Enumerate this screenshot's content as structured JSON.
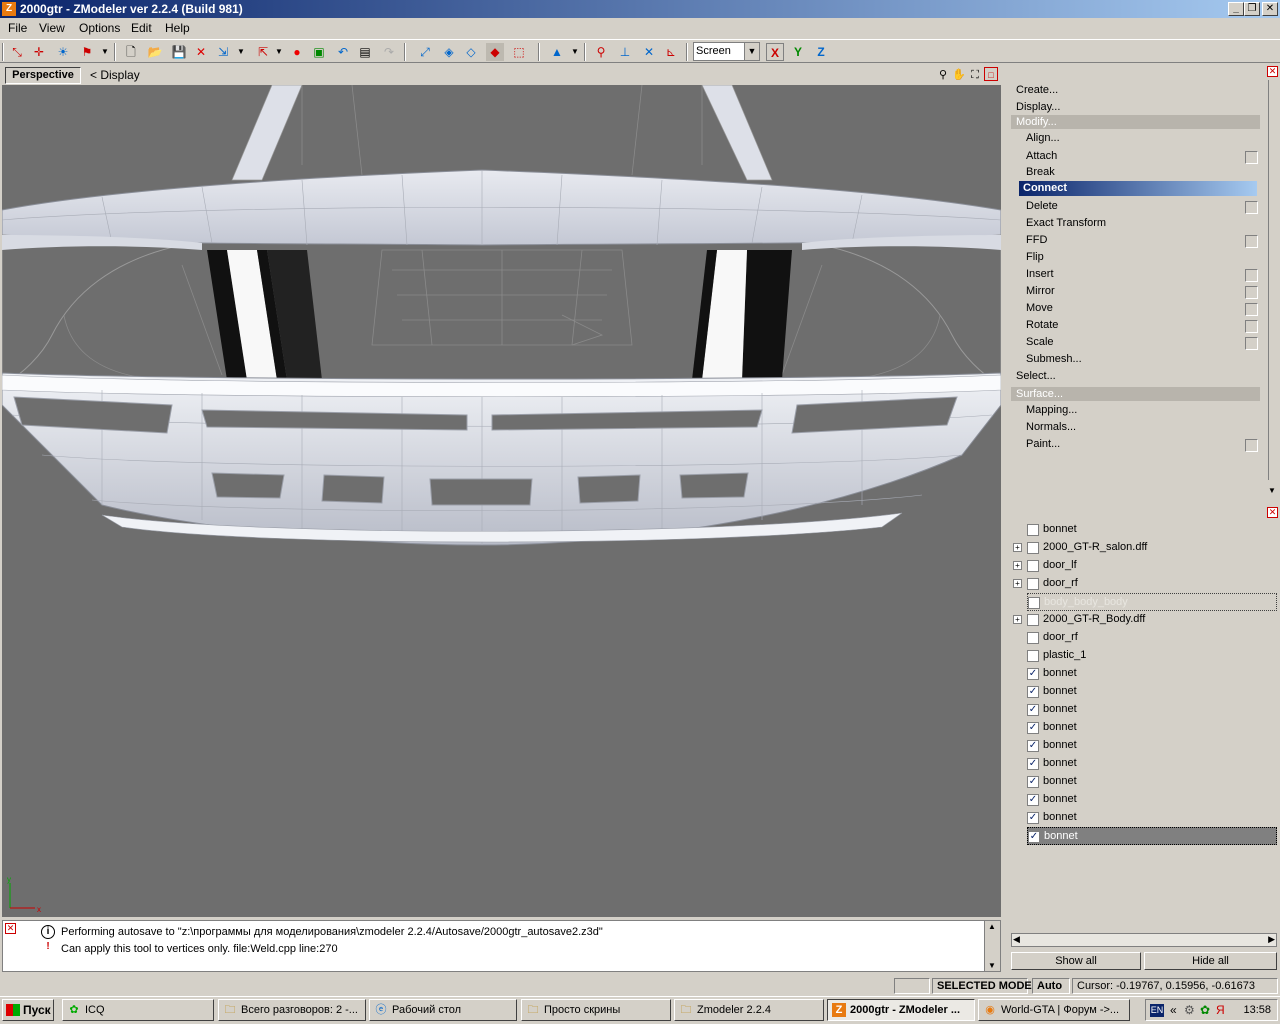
{
  "window": {
    "title": "2000gtr - ZModeler ver 2.2.4 (Build 981)",
    "app_icon_letter": "Z",
    "minimize": "_",
    "maximize": "❐",
    "close": "✕"
  },
  "menu": [
    "File",
    "View",
    "Options",
    "Edit",
    "Help"
  ],
  "toolbar": {
    "view_select": "Screen",
    "axis_x": "X",
    "axis_y": "Y",
    "axis_z": "Z"
  },
  "viewport": {
    "tab": "Perspective",
    "display": "< Display"
  },
  "command_panel": {
    "items": [
      {
        "label": "Create...",
        "kind": "top"
      },
      {
        "label": "Display...",
        "kind": "top"
      },
      {
        "label": "Modify...",
        "kind": "group"
      },
      {
        "label": "Align...",
        "kind": "sub"
      },
      {
        "label": "Attach",
        "kind": "sub",
        "box": true
      },
      {
        "label": "Break",
        "kind": "sub"
      },
      {
        "label": "Connect",
        "kind": "selected"
      },
      {
        "label": "Delete",
        "kind": "sub",
        "box": true
      },
      {
        "label": "Exact Transform",
        "kind": "sub"
      },
      {
        "label": "FFD",
        "kind": "sub",
        "box": true
      },
      {
        "label": "Flip",
        "kind": "sub"
      },
      {
        "label": "Insert",
        "kind": "sub",
        "box": true
      },
      {
        "label": "Mirror",
        "kind": "sub",
        "box": true
      },
      {
        "label": "Move",
        "kind": "sub",
        "box": true
      },
      {
        "label": "Rotate",
        "kind": "sub",
        "box": true
      },
      {
        "label": "Scale",
        "kind": "sub",
        "box": true
      },
      {
        "label": "Submesh...",
        "kind": "sub"
      },
      {
        "label": "Select...",
        "kind": "top"
      },
      {
        "label": "Surface...",
        "kind": "group"
      },
      {
        "label": "Mapping...",
        "kind": "sub"
      },
      {
        "label": "Normals...",
        "kind": "sub"
      },
      {
        "label": "Paint...",
        "kind": "sub",
        "box": true
      }
    ]
  },
  "object_tree": {
    "rows": [
      {
        "label": "bonnet",
        "expandable": false,
        "checked": false
      },
      {
        "label": "2000_GT-R_salon.dff",
        "expandable": true,
        "checked": false
      },
      {
        "label": "door_lf",
        "expandable": true,
        "checked": false
      },
      {
        "label": "door_rf",
        "expandable": true,
        "checked": false
      },
      {
        "label": "body_body_body",
        "expandable": false,
        "checked": false,
        "dim": true
      },
      {
        "label": "2000_GT-R_Body.dff",
        "expandable": true,
        "checked": false
      },
      {
        "label": "door_rf",
        "expandable": false,
        "checked": false
      },
      {
        "label": "plastic_1",
        "expandable": false,
        "checked": false
      },
      {
        "label": "bonnet",
        "expandable": false,
        "checked": true
      },
      {
        "label": "bonnet",
        "expandable": false,
        "checked": true
      },
      {
        "label": "bonnet",
        "expandable": false,
        "checked": true
      },
      {
        "label": "bonnet",
        "expandable": false,
        "checked": true
      },
      {
        "label": "bonnet",
        "expandable": false,
        "checked": true
      },
      {
        "label": "bonnet",
        "expandable": false,
        "checked": true
      },
      {
        "label": "bonnet",
        "expandable": false,
        "checked": true
      },
      {
        "label": "bonnet",
        "expandable": false,
        "checked": true
      },
      {
        "label": "bonnet",
        "expandable": false,
        "checked": true
      },
      {
        "label": "bonnet",
        "expandable": false,
        "checked": true,
        "highlighted": true
      }
    ],
    "show_all": "Show all",
    "hide_all": "Hide all"
  },
  "log": {
    "lines": [
      {
        "icon": "i",
        "text": "Performing autosave to \"z:\\программы для моделирования\\zmodeler 2.2.4/Autosave/2000gtr_autosave2.z3d\""
      },
      {
        "icon": "!",
        "text": "Can apply this tool to vertices only. file:Weld.cpp line:270"
      }
    ]
  },
  "status": {
    "mode": "SELECTED MODE",
    "auto": "Auto",
    "cursor": "Cursor: -0.19767, 0.15956, -0.61673"
  },
  "taskbar": {
    "start": "Пуск",
    "tasks": [
      {
        "label": "ICQ",
        "active": false
      },
      {
        "label": "Всего разговоров: 2 -...",
        "active": false
      },
      {
        "label": "Рабочий стол",
        "active": false
      },
      {
        "label": "Просто скрины",
        "active": false
      },
      {
        "label": "Zmodeler 2.2.4",
        "active": false
      },
      {
        "label": "2000gtr - ZModeler ...",
        "active": true
      },
      {
        "label": "World-GTA | Форум ->...",
        "active": false
      }
    ],
    "lang": "EN",
    "clock": "13:58"
  }
}
